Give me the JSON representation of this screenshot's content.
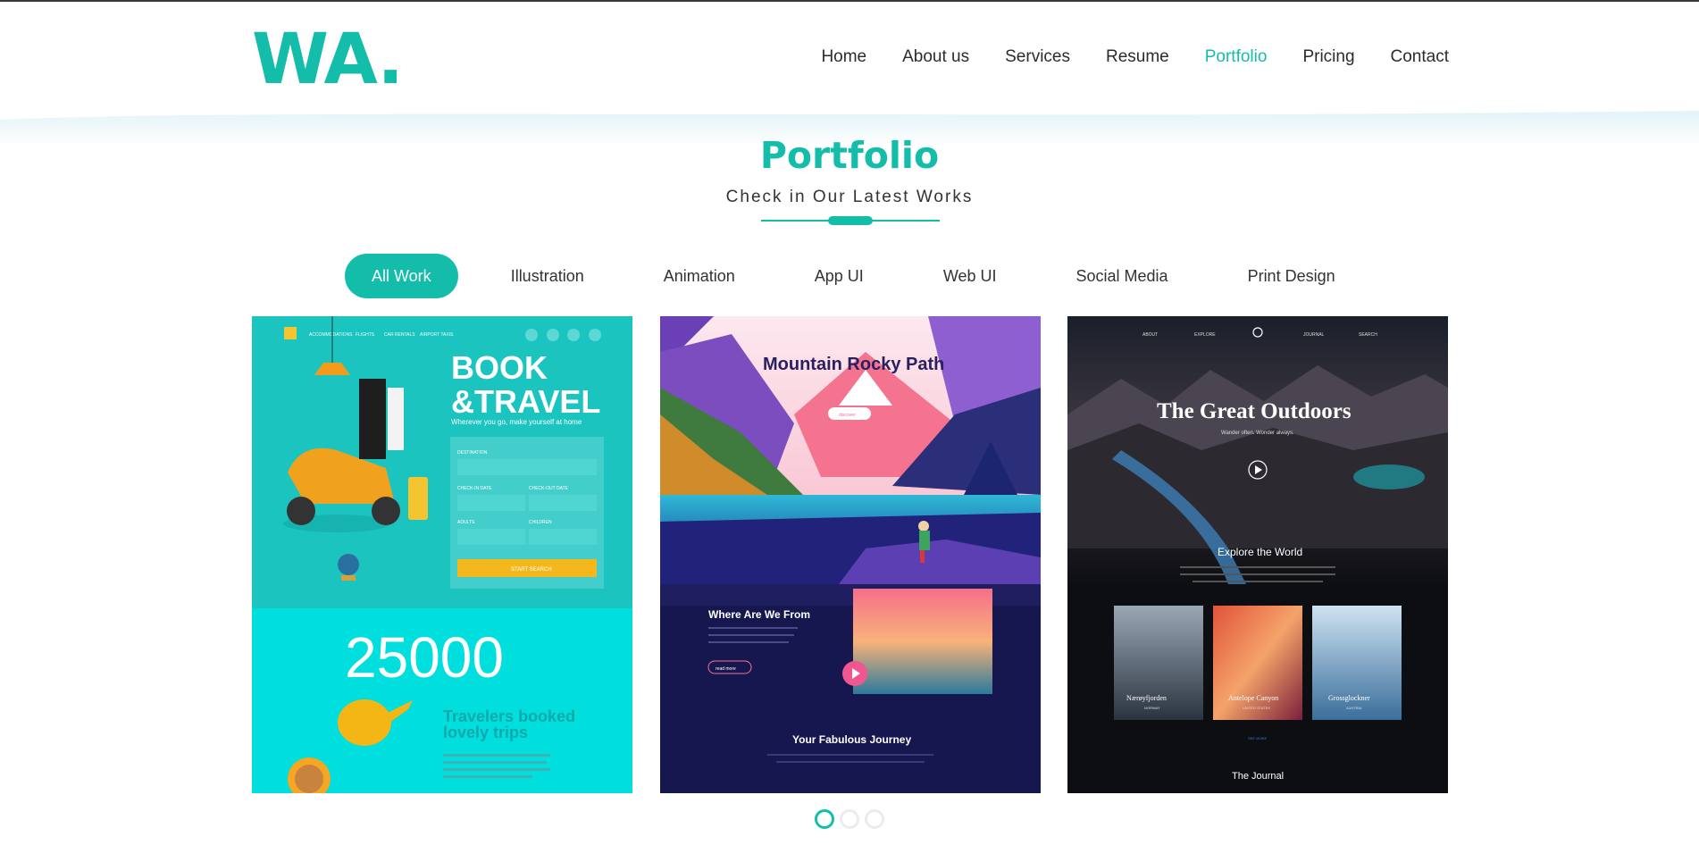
{
  "header": {
    "logo_text": "WA",
    "logo_dot": ".",
    "nav": [
      {
        "label": "Home",
        "active": false
      },
      {
        "label": "About us",
        "active": false
      },
      {
        "label": "Services",
        "active": false
      },
      {
        "label": "Resume",
        "active": false
      },
      {
        "label": "Portfolio",
        "active": true
      },
      {
        "label": "Pricing",
        "active": false
      },
      {
        "label": "Contact",
        "active": false
      }
    ]
  },
  "section": {
    "title": "Portfolio",
    "subtitle": "Check in Our Latest Works"
  },
  "filters": [
    {
      "label": "All Work",
      "active": true
    },
    {
      "label": "Illustration",
      "active": false
    },
    {
      "label": "Animation",
      "active": false
    },
    {
      "label": "App UI",
      "active": false
    },
    {
      "label": "Web UI",
      "active": false
    },
    {
      "label": "Social Media",
      "active": false
    },
    {
      "label": "Print Design",
      "active": false
    }
  ],
  "cards": {
    "travel": {
      "nav": [
        "ACCOMMODATIONS",
        "FLIGHTS",
        "CAR RENTALS",
        "AIRPORT TAXIS"
      ],
      "headline_1": "BOOK",
      "headline_2": "&TRAVEL",
      "tagline": "Wherever you go, make yourself at home",
      "form_destination": "DESTINATION",
      "form_checkin": "CHECK-IN DATE",
      "form_checkout": "CHECK-OUT DATE",
      "form_adults": "ADULTS",
      "form_children": "CHILDREN",
      "form_search": "START SEARCH",
      "stat_number": "25000",
      "stat_text_1": "Travelers booked",
      "stat_text_2": "lovely trips"
    },
    "mountain": {
      "title": "Mountain Rocky Path",
      "button": "discover",
      "section_1": "Where Are We From",
      "readmore": "read more",
      "section_2": "Your Fabulous Journey"
    },
    "outdoors": {
      "nav": [
        "ABOUT",
        "EXPLORE",
        "JOURNAL",
        "SEARCH"
      ],
      "title": "The Great Outdoors",
      "tagline": "Wander often. Wonder always.",
      "section_1": "Explore the World",
      "places": [
        {
          "name": "Nærøyfjorden",
          "country": "NORWAY"
        },
        {
          "name": "Antelope Canyon",
          "country": "UNITED STATES"
        },
        {
          "name": "Grossglockner",
          "country": "AUSTRIA"
        }
      ],
      "see_more": "SEE MORE",
      "section_2": "The Journal"
    }
  },
  "pagination": {
    "pages": 3,
    "active": 1
  },
  "colors": {
    "accent": "#14bdaa",
    "text": "#333333"
  }
}
